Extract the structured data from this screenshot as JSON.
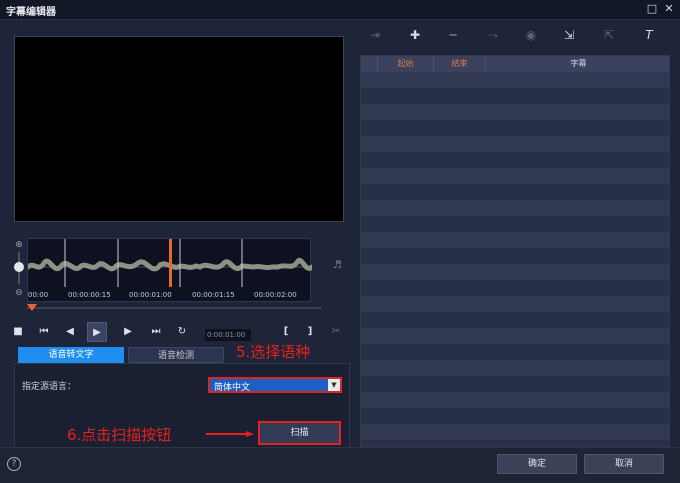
{
  "window": {
    "title": "字幕编辑器",
    "maximize_icon": "maximize-icon",
    "close_icon": "close-icon"
  },
  "waveform": {
    "ticks": [
      "00:00",
      "00:00:00:15",
      "00:00:01:00",
      "00:00:01:15",
      "00:00:02:00"
    ],
    "playhead_color": "#e8672c"
  },
  "transport": {
    "buttons": [
      "stop-icon",
      "previous-icon",
      "frame-back-icon",
      "play-icon",
      "frame-forward-icon",
      "next-icon",
      "loop-icon"
    ],
    "timecode": "0:00:01:00",
    "mark_in": "[",
    "mark_out": "]"
  },
  "tabs": {
    "speech_to_text": "语音转文字",
    "speech_detection": "语音检测"
  },
  "language": {
    "label": "指定源语言：",
    "selected": "简体中文"
  },
  "scan_button": "扫描",
  "annotations": {
    "step5": "5.选择语种",
    "step6": "6.点击扫描按钮"
  },
  "annotation_color": "#e0241e",
  "subtitle_toolbar": [
    "play-subtitle-icon",
    "add-icon",
    "remove-icon",
    "jump-icon",
    "sync-icon",
    "import-icon",
    "export-icon",
    "text-format-icon"
  ],
  "subtitle_table": {
    "columns": [
      "",
      "起始",
      "结束",
      "字幕"
    ],
    "header_highlight": "#e07a3a"
  },
  "footer": {
    "ok": "确定",
    "cancel": "取消"
  }
}
